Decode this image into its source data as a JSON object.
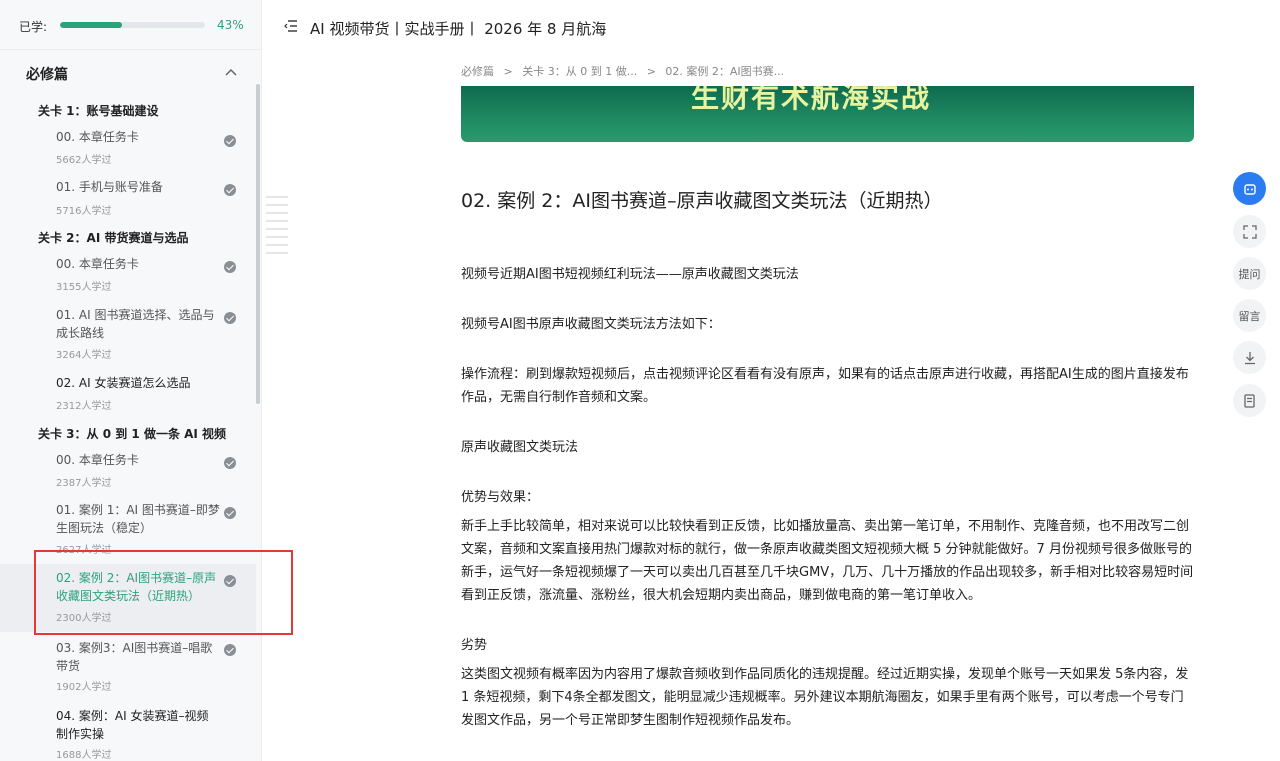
{
  "sidebar": {
    "progress_label": "已学:",
    "progress_value": 0.43,
    "progress_text": "43%",
    "section_title": "必修篇",
    "levels": [
      {
        "label": "关卡 1：账号基础建设"
      },
      {
        "label": "关卡 2：AI 带货赛道与选品"
      },
      {
        "label": "关卡 3：从 0 到 1 做一条 AI 视频"
      }
    ],
    "lessons": [
      {
        "title": "00. 本章任务卡",
        "count": "5662人学过"
      },
      {
        "title": "01. 手机与账号准备",
        "count": "5716人学过"
      },
      {
        "title": "00. 本章任务卡",
        "count": "3155人学过"
      },
      {
        "title": "01. AI 图书赛道选择、选品与成长路线",
        "count": "3264人学过"
      },
      {
        "title": "02. AI 女装赛道怎么选品",
        "count": "2312人学过"
      },
      {
        "title": "00. 本章任务卡",
        "count": "2387人学过"
      },
      {
        "title": "01. 案例 1：AI 图书赛道–即梦生图玩法（稳定）",
        "count": "2627人学过"
      },
      {
        "title": "02. 案例 2：AI图书赛道–原声收藏图文类玩法（近期热）",
        "count": "2300人学过"
      },
      {
        "title": "03. 案例3：AI图书赛道–唱歌带货",
        "count": "1902人学过"
      },
      {
        "title": "04. 案例：AI 女装赛道–视频制作实操",
        "count": "1688人学过"
      }
    ]
  },
  "header": {
    "title": "AI 视频带货丨实战手册丨 2026 年 8 月航海"
  },
  "breadcrumb": [
    "必修篇",
    ">",
    "关卡 3：从 0 到 1 做...",
    ">",
    "02. 案例 2：AI图书赛..."
  ],
  "banner_text": "生财有术航海实战",
  "article": {
    "title": "02. 案例 2：AI图书赛道–原声收藏图文类玩法（近期热）",
    "paragraphs": [
      "视频号近期AI图书短视频红利玩法——原声收藏图文类玩法",
      "视频号AI图书原声收藏图文类玩法方法如下：",
      "操作流程：刷到爆款短视频后，点击视频评论区看看有没有原声，如果有的话点击原声进行收藏，再搭配AI生成的图片直接发布作品，无需自行制作音频和文案。",
      "原声收藏图文类玩法",
      "优势与效果：",
      "新手上手比较简单，相对来说可以比较快看到正反馈，比如播放量高、卖出第一笔订单，不用制作、克隆音频，也不用改写二创文案，音频和文案直接用热门爆款对标的就行，做一条原声收藏类图文短视频大概 5 分钟就能做好。7 月份视频号很多做账号的新手，运气好一条短视频爆了一天可以卖出几百甚至几千块GMV，几万、几十万播放的作品出现较多，新手相对比较容易短时间看到正反馈，涨流量、涨粉丝，很大机会短期内卖出商品，赚到做电商的第一笔订单收入。",
      "劣势",
      "这类图文视频有概率因为内容用了爆款音频收到作品同质化的违规提醒。经过近期实操，发现单个账号一天如果发 5条内容，发 1 条短视频，剩下4条全都发图文，能明显减少违规概率。另外建议本期航海圈友，如果手里有两个账号，可以考虑一个号专门发图文作品，另一个号正常即梦生图制作短视频作品发布。"
    ]
  },
  "floating": {
    "ask": "提问",
    "comment": "留言"
  },
  "colors": {
    "accent": "#2aa37a",
    "highlight": "#e53935",
    "primary_button": "#2b7cf0"
  }
}
